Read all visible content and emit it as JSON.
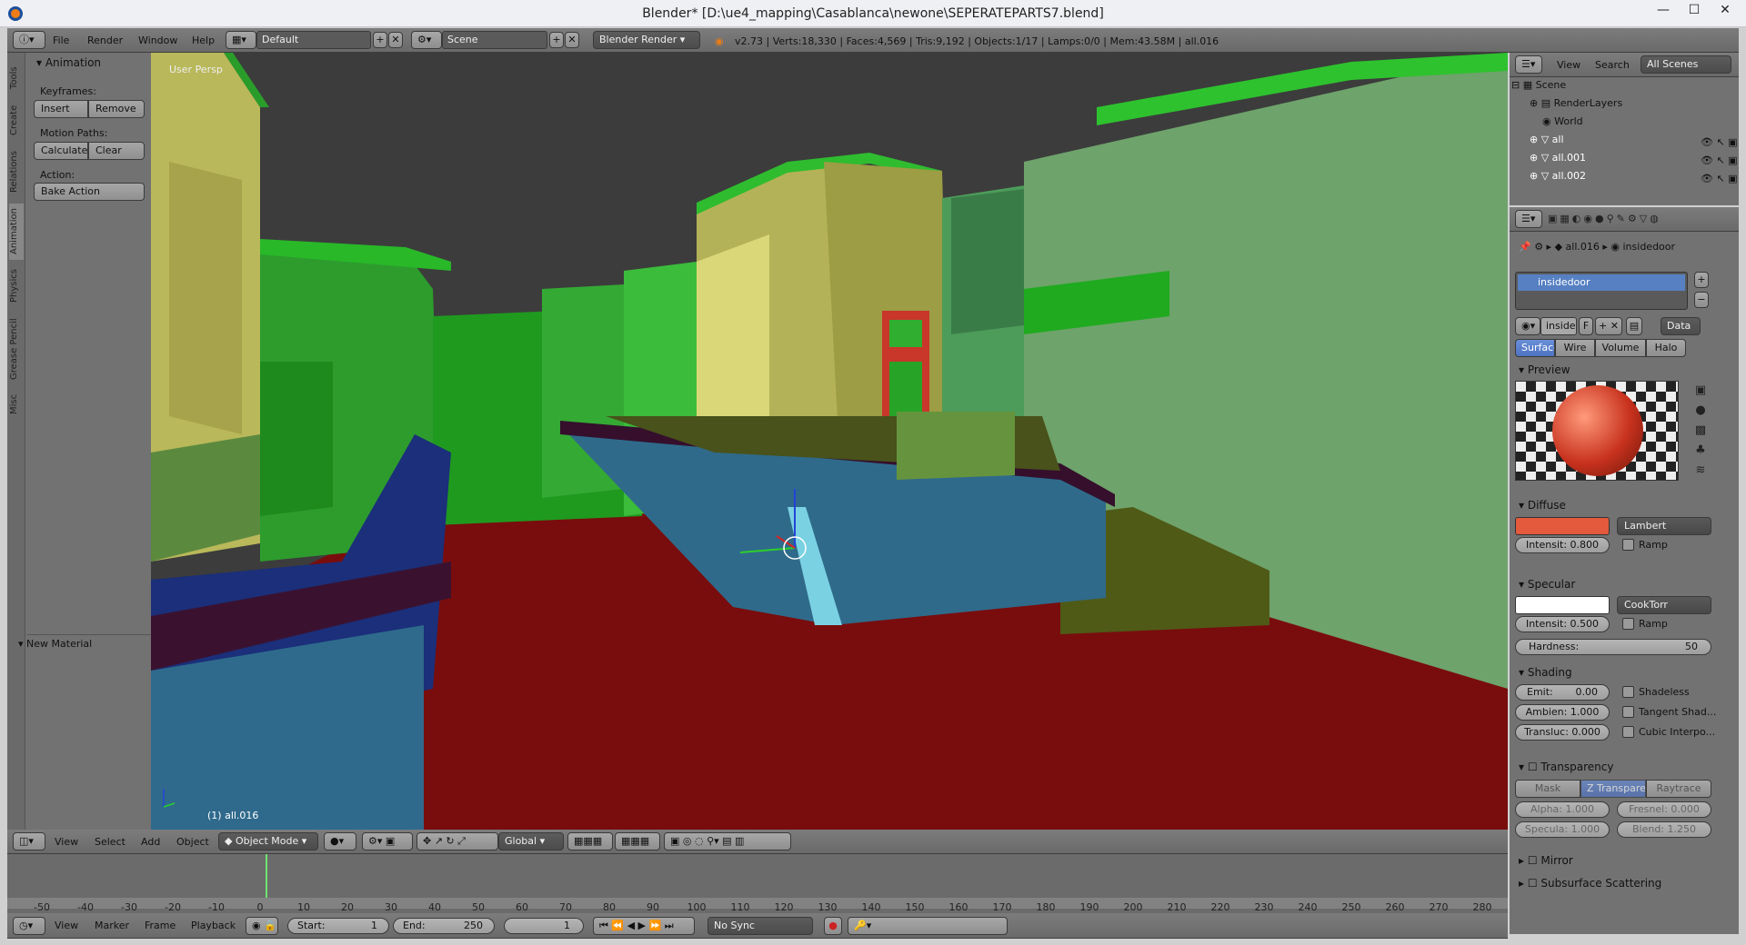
{
  "window": {
    "title": "Blender* [D:\\ue4_mapping\\Casablanca\\newone\\SEPERATEPARTS7.blend]",
    "min": "—",
    "max": "☐",
    "close": "✕"
  },
  "info_header": {
    "menus": [
      "File",
      "Render",
      "Window",
      "Help"
    ],
    "layout": "Default",
    "scene": "Scene",
    "engine": "Blender Render",
    "stats": "v2.73 | Verts:18,330 | Faces:4,569 | Tris:9,192 | Objects:1/17 | Lamps:0/0 | Mem:43.58M | all.016"
  },
  "tool_shelf": {
    "tabs": [
      "Tools",
      "Create",
      "Relations",
      "Animation",
      "Physics",
      "Grease Pencil",
      "Misc"
    ],
    "panel_title": "Animation",
    "keyframes_label": "Keyframes:",
    "insert": "Insert",
    "remove": "Remove",
    "motion_label": "Motion Paths:",
    "calculate": "Calculate",
    "clear": "Clear",
    "action_label": "Action:",
    "bake": "Bake Action",
    "new_material": "New Material"
  },
  "viewport": {
    "persp_label": "User Persp",
    "object_label": "(1) all.016"
  },
  "view3d_header": {
    "menus": [
      "View",
      "Select",
      "Add",
      "Object"
    ],
    "mode": "Object Mode",
    "orientation": "Global"
  },
  "outliner": {
    "menus": [
      "View",
      "Search"
    ],
    "filter": "All Scenes",
    "rows": [
      {
        "label": "Scene"
      },
      {
        "label": "RenderLayers"
      },
      {
        "label": "World"
      },
      {
        "label": "all"
      },
      {
        "label": "all.001"
      },
      {
        "label": "all.002"
      }
    ]
  },
  "properties": {
    "breadcrumb_obj": "all.016",
    "breadcrumb_mat": "insidedoor",
    "material_slot": "insidedoor",
    "mat_name": "inside",
    "f_label": "F",
    "data_label": "Data",
    "tabs": [
      "Surface",
      "Wire",
      "Volume",
      "Halo"
    ],
    "preview": "Preview",
    "diffuse": "Diffuse",
    "diffuse_color": "#e35a3c",
    "diffuse_shader": "Lambert",
    "diffuse_intensity": "Intensit: 0.800",
    "ramp": "Ramp",
    "specular": "Specular",
    "specular_color": "#ffffff",
    "specular_shader": "CookTorr",
    "specular_intensity": "Intensit: 0.500",
    "hardness_label": "Hardness:",
    "hardness": "50",
    "shading": "Shading",
    "emit": "Emit:",
    "emit_v": "0.00",
    "ambient": "Ambien: 1.000",
    "transluc": "Transluc: 0.000",
    "shadeless": "Shadeless",
    "tangent": "Tangent Shad...",
    "cubic": "Cubic Interpo...",
    "transparency": "Transparency",
    "mask": "Mask",
    "ztransp": "Z Transpare...",
    "raytrace": "Raytrace",
    "alpha": "Alpha: 1.000",
    "fresnel": "Fresnel: 0.000",
    "specula": "Specula: 1.000",
    "blend": "Blend: 1.250",
    "mirror": "Mirror",
    "sss": "Subsurface Scattering"
  },
  "timeline": {
    "ticks": [
      "-50",
      "-40",
      "-30",
      "-20",
      "-10",
      "0",
      "10",
      "20",
      "30",
      "40",
      "50",
      "60",
      "70",
      "80",
      "90",
      "100",
      "110",
      "120",
      "130",
      "140",
      "150",
      "160",
      "170",
      "180",
      "190",
      "200",
      "210",
      "220",
      "230",
      "240",
      "250",
      "260",
      "270",
      "280"
    ],
    "menus": [
      "View",
      "Marker",
      "Frame",
      "Playback"
    ],
    "start": "Start:",
    "start_v": "1",
    "end": "End:",
    "end_v": "250",
    "current": "1",
    "sync": "No Sync"
  }
}
